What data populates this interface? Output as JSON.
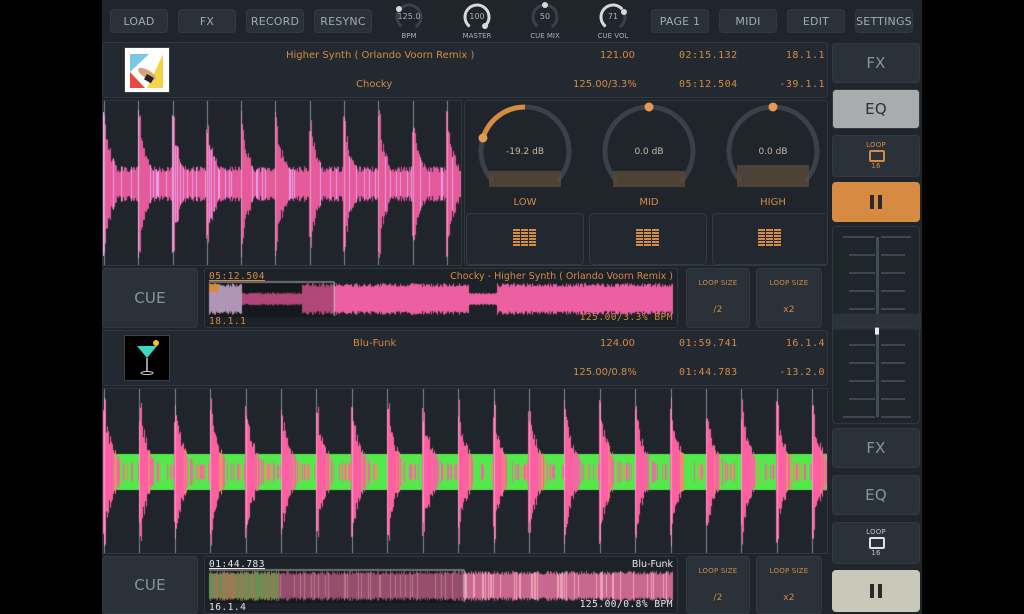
{
  "toolbar": {
    "buttons": [
      "LOAD",
      "FX",
      "RECORD",
      "RESYNC",
      "PAGE 1",
      "MIDI",
      "EDIT",
      "SETTINGS"
    ],
    "knobs": [
      {
        "label": "BPM",
        "value": "125.0",
        "fraction": 0.0
      },
      {
        "label": "MASTER",
        "value": "100",
        "fraction": 1.0
      },
      {
        "label": "CUE MIX",
        "value": "50",
        "fraction": 0.5
      },
      {
        "label": "CUE VOL",
        "value": "71",
        "fraction": 0.71
      }
    ]
  },
  "deck_a": {
    "title": "Higher Synth ( Orlando Voorn Remix )",
    "artist": "Chocky",
    "original_bpm": "121.00",
    "bpm_pitch": "125.00/3.3%",
    "time_total": "02:15.132",
    "time_remaining": "05:12.504",
    "beat_position": "18.1.1",
    "beat_remaining": "-39.1.1",
    "eq": [
      {
        "label": "LOW",
        "value": "-19.2 dB",
        "fraction": 0.22
      },
      {
        "label": "MID",
        "value": "0.0 dB",
        "fraction": 0.5
      },
      {
        "label": "HIGH",
        "value": "0.0 dB",
        "fraction": 0.5
      }
    ],
    "cue_label": "CUE",
    "overview": {
      "time": "05:12.504",
      "track": "Chocky - Higher Synth ( Orlando Voorn Remix )",
      "beat": "18.1.1",
      "bpm": "125.00/3.3% BPM",
      "progress": 0.27
    },
    "loop_buttons": [
      {
        "title": "LOOP SIZE",
        "value": "/2"
      },
      {
        "title": "LOOP SIZE",
        "value": "x2"
      }
    ],
    "side": {
      "fx": "FX",
      "eq": "EQ",
      "loop": "LOOP",
      "loop_size": "16",
      "eq_active": true,
      "playing": true
    }
  },
  "deck_b": {
    "title": "Blu-Funk",
    "artist": "",
    "original_bpm": "124.00",
    "bpm_pitch": "125.00/0.8%",
    "time_total": "01:59.741",
    "time_remaining": "01:44.783",
    "beat_position": "16.1.4",
    "beat_remaining": "-13.2.0",
    "cue_label": "CUE",
    "overview": {
      "time": "01:44.783",
      "track": "Blu-Funk",
      "beat": "16.1.4",
      "bpm": "125.00/0.8% BPM",
      "progress": 0.55
    },
    "loop_buttons": [
      {
        "title": "LOOP SIZE",
        "value": "/2"
      },
      {
        "title": "LOOP SIZE",
        "value": "x2"
      }
    ],
    "side": {
      "fx": "FX",
      "eq": "EQ",
      "loop": "LOOP",
      "loop_size": "16",
      "eq_active": false,
      "playing": true
    }
  },
  "crossfader": {
    "position": 0.47
  },
  "colors": {
    "accent": "#d68a42",
    "wave_pink": "#e85a9c",
    "wave_green": "#55e84a",
    "eq_active_bg": "#a9acae",
    "play_a_bg": "#d68a42",
    "play_b_bg": "#c9c9b9"
  }
}
